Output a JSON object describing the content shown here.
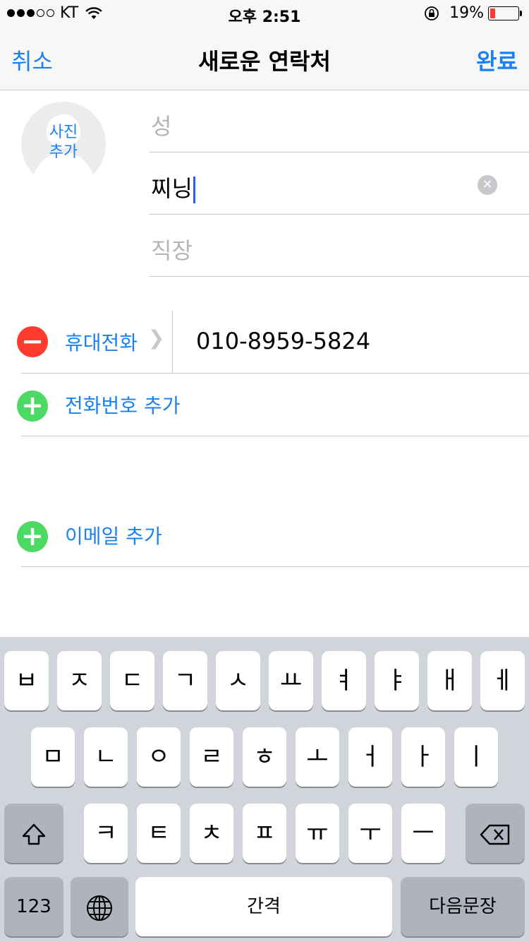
{
  "status_bar": {
    "carrier": "KT",
    "time": "오후 2:51",
    "battery": "19%",
    "battery_level": 0.19,
    "signal_filled": 3,
    "signal_total": 5
  },
  "nav": {
    "cancel": "취소",
    "title": "새로운 연락처",
    "done": "완료"
  },
  "photo": {
    "label": "사진\n추가"
  },
  "fields": {
    "last_name_placeholder": "성",
    "first_name_value": "찌닝",
    "company_placeholder": "직장"
  },
  "phone": {
    "type_label": "휴대전화",
    "number": "010-8959-5824",
    "add_label": "전화번호 추가"
  },
  "email": {
    "add_label": "이메일 추가"
  },
  "keyboard": {
    "row1": [
      "ㅂ",
      "ㅈ",
      "ㄷ",
      "ㄱ",
      "ㅅ",
      "ㅛ",
      "ㅕ",
      "ㅑ",
      "ㅐ",
      "ㅔ"
    ],
    "row2": [
      "ㅁ",
      "ㄴ",
      "ㅇ",
      "ㄹ",
      "ㅎ",
      "ㅗ",
      "ㅓ",
      "ㅏ",
      "ㅣ"
    ],
    "row3": [
      "ㅋ",
      "ㅌ",
      "ㅊ",
      "ㅍ",
      "ㅠ",
      "ㅜ",
      "ㅡ"
    ],
    "numbers": "123",
    "space": "간격",
    "return": "다음문장"
  },
  "colors": {
    "accent": "#1a82f0",
    "delete": "#ff3b30",
    "add": "#4cd964"
  }
}
